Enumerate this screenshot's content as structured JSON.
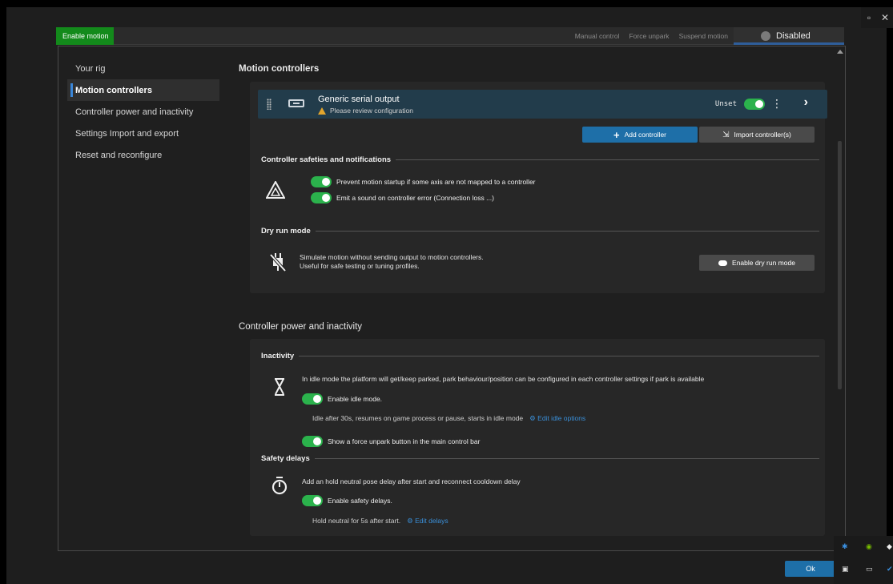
{
  "window": {
    "restore_glyph": "▫",
    "close_glyph": "✕"
  },
  "topbar": {
    "enable_motion": "Enable motion",
    "nav": [
      "Manual control",
      "Force unpark",
      "Suspend motion"
    ],
    "state": "Disabled"
  },
  "sidebar": {
    "items": [
      {
        "label": "Your rig"
      },
      {
        "label": "Motion controllers"
      },
      {
        "label": "Controller power and inactivity"
      },
      {
        "label": "Settings Import and export"
      },
      {
        "label": "Reset and reconfigure"
      }
    ]
  },
  "motion_controllers": {
    "title": "Motion controllers",
    "controller": {
      "name": "Generic serial output",
      "warning": "Please review configuration",
      "status": "Unset",
      "enabled": true
    },
    "add_label": "Add controller",
    "import_label": "Import controller(s)",
    "safeties": {
      "heading": "Controller safeties and notifications",
      "options": [
        {
          "label": "Prevent motion startup if some axis are not mapped to a controller",
          "on": true
        },
        {
          "label": "Emit a sound on controller error (Connection loss ...)",
          "on": true
        }
      ]
    },
    "dry_run": {
      "heading": "Dry run mode",
      "line1": "Simulate motion without sending output to motion controllers.",
      "line2": "Useful for safe testing or tuning profiles.",
      "button": "Enable dry run mode"
    }
  },
  "power": {
    "title": "Controller power and inactivity",
    "inactivity": {
      "heading": "Inactivity",
      "description": "In idle mode the platform will get/keep parked, park behaviour/position can be configured in each controller settings if park is available",
      "idle_toggle": "Enable idle mode.",
      "idle_summary": "Idle after 30s, resumes on game process or pause, starts in idle mode",
      "idle_link": "Edit idle options",
      "unpark_toggle": "Show a force unpark button in the main control bar"
    },
    "safety": {
      "heading": "Safety delays",
      "description": "Add an hold neutral pose delay after start and reconnect cooldown delay",
      "toggle": "Enable safety delays.",
      "summary": "Hold neutral for 5s after start.",
      "link": "Edit delays"
    }
  },
  "footer": {
    "ok": "Ok"
  },
  "colors": {
    "accent": "#1e6fa8",
    "enable_green": "#138a1b",
    "toggle_on": "#2bb24c",
    "warning": "#e2a52d"
  }
}
